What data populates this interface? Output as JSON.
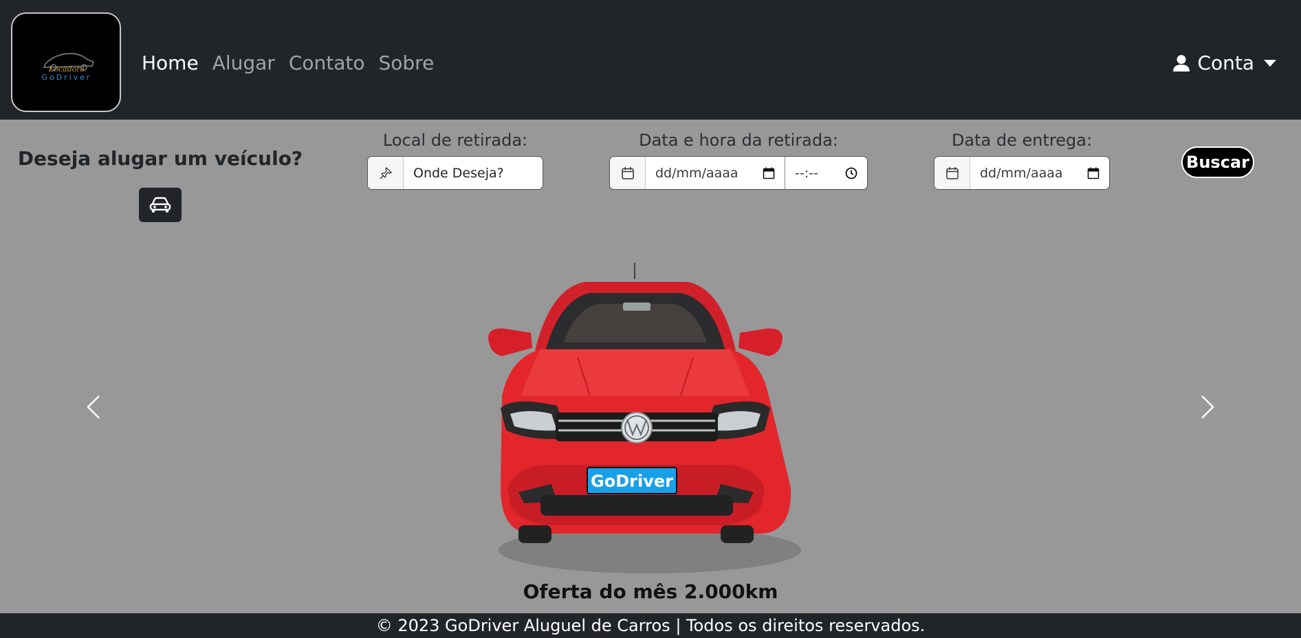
{
  "brand": {
    "logo_line1": "Locadora",
    "logo_line2": "GoDriver"
  },
  "nav": {
    "links": [
      "Home",
      "Alugar",
      "Contato",
      "Sobre"
    ],
    "active": "Home",
    "account_label": "Conta"
  },
  "search": {
    "question": "Deseja alugar um veículo?",
    "pickup_location_label": "Local de retirada:",
    "pickup_location_placeholder": "Onde Deseja?",
    "pickup_datetime_label": "Data e hora da retirada:",
    "pickup_date_placeholder": "dd/mm/aaaa",
    "pickup_time_placeholder": "--:--",
    "return_date_label": "Data de entrega:",
    "return_date_placeholder": "dd/mm/aaaa",
    "submit_label": "Buscar"
  },
  "carousel": {
    "caption": "Oferta do mês 2.000km",
    "plate_text": "GoDriver"
  },
  "footer": {
    "text": "© 2023 GoDriver Aluguel de Carros | Todos os direitos reservados."
  },
  "colors": {
    "navbar": "#212529",
    "page_background": "#989898",
    "car_red": "#e3262b",
    "plate_blue": "#1aa0e8"
  },
  "icons": {
    "account": "person-icon",
    "car_button": "car-icon",
    "location": "pin-icon",
    "calendar": "calendar-icon",
    "clock": "clock-icon"
  }
}
